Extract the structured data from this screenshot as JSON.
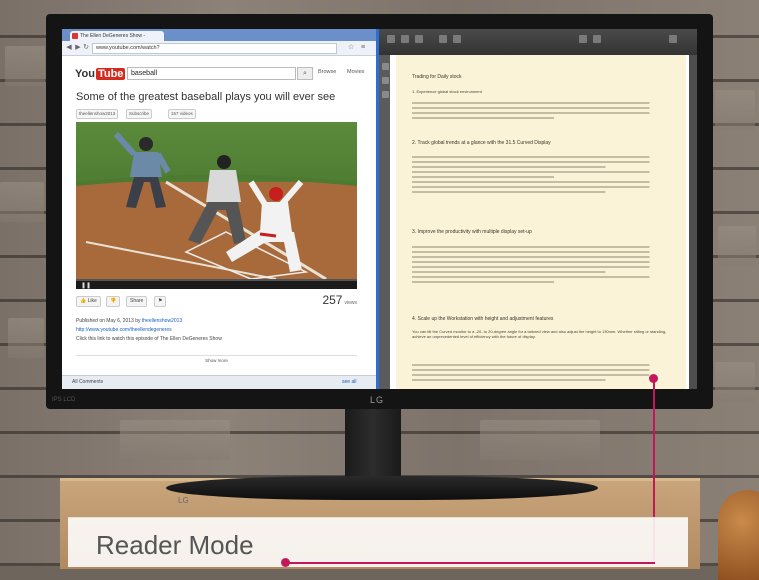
{
  "monitor": {
    "brand": "LG",
    "bezel_label": "IPS LCD"
  },
  "browser": {
    "tab_title": "The Ellen DeGeneres Show -",
    "address": "www.youtube.com/watch?",
    "youtube": {
      "logo_you": "You",
      "logo_tube": "Tube",
      "search_value": "baseball",
      "links": [
        "Browse",
        "Movies"
      ],
      "video_title": "Some of the greatest baseball plays you will ever see",
      "channel": "theellenshow2013",
      "subscribe": "Subscribe",
      "videos_count": "157 videos",
      "like_label": "Like",
      "share_label": "Share",
      "views_count": "257",
      "views_label": "views",
      "published": "Published on May 6, 2013 by",
      "published_by": "theellenshow2013",
      "desc_link": "http://www.youtube.com/theellendegeneres",
      "desc_text": "Click this link to watch this episode of The Ellen DeGeneres Show",
      "show_more": "Show more"
    },
    "status_left": "All Comments",
    "status_right": "see all"
  },
  "reader": {
    "heading": "Trading for Daily stock",
    "sub1": "1. Experience global stock environment",
    "sec2": "2. Track global trends at a glance with the 31.5 Curved Display",
    "sec3": "3. Improve the productivity with multiple display set-up",
    "sec4": "4. Scale up the Workstation with height and adjustment features",
    "sec4_body": "You can tilt the Curved monitor to a -20- to 20-degree angle for a tailored view and also adjust the height to 130mm. Whether sitting or standing, achieve an unprecedented level of efficiency with the future of display."
  },
  "callout": {
    "label": "Reader Mode",
    "accent": "#c2185b"
  }
}
